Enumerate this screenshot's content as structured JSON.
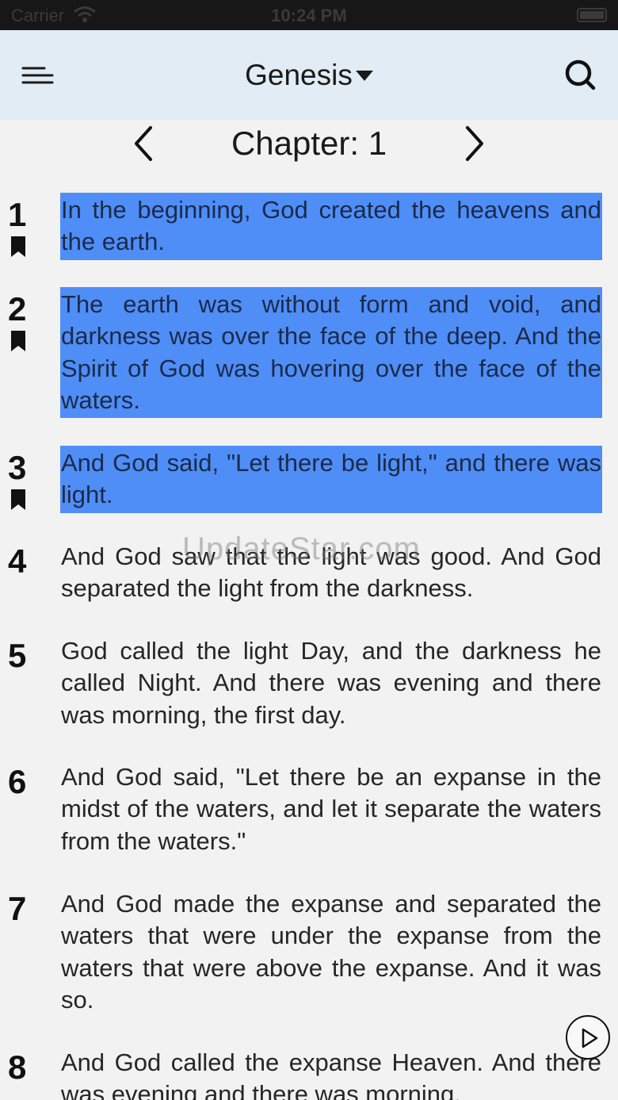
{
  "status_bar": {
    "carrier": "Carrier",
    "time": "10:24 PM"
  },
  "header": {
    "book_title": "Genesis",
    "icons": [
      "menu-icon",
      "chevron-down-icon",
      "search-icon"
    ]
  },
  "chapter": {
    "label": "Chapter: 1",
    "icons": [
      "chevron-left-icon",
      "chevron-right-icon"
    ]
  },
  "colors": {
    "highlight": "#4f8ef7",
    "nav_background": "#e1ecf5",
    "background": "#f2f2f2"
  },
  "watermark": "UpdateStar.com",
  "verses": [
    {
      "number": "1",
      "text": "In the beginning, God created the heavens and the earth.",
      "highlighted": true,
      "bookmarked": true
    },
    {
      "number": "2",
      "text": "The earth was without form and void, and darkness was over the face of the deep. And the Spirit of God was hovering over the face of the waters.",
      "highlighted": true,
      "bookmarked": true
    },
    {
      "number": "3",
      "text": "And God said, \"Let there be light,\" and there was light.",
      "highlighted": true,
      "bookmarked": true
    },
    {
      "number": "4",
      "text": "And God saw that the light was good. And God separated the light from the darkness.",
      "highlighted": false,
      "bookmarked": false
    },
    {
      "number": "5",
      "text": "God called the light Day, and the darkness he called Night. And there was evening and there was morning, the first day.",
      "highlighted": false,
      "bookmarked": false
    },
    {
      "number": "6",
      "text": "And God said, \"Let there be an expanse in the midst of the waters, and let it separate the waters from the waters.\"",
      "highlighted": false,
      "bookmarked": false
    },
    {
      "number": "7",
      "text": "And God made the expanse and separated the waters that were under the expanse from the waters that were above the expanse. And it was so.",
      "highlighted": false,
      "bookmarked": false
    },
    {
      "number": "8",
      "text": "And God called the expanse Heaven. And there was evening and there was morning,",
      "highlighted": false,
      "bookmarked": false
    }
  ],
  "play_button": {
    "icon": "play-icon"
  }
}
